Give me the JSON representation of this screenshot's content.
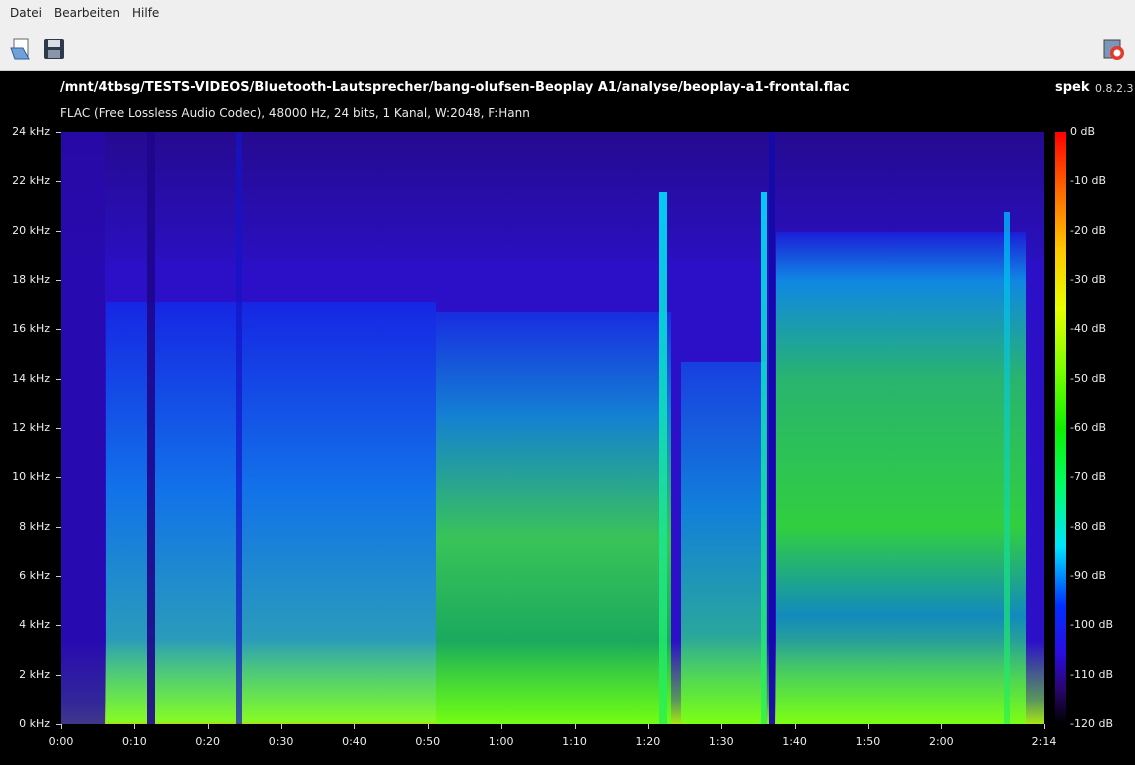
{
  "menubar": {
    "items": [
      "Datei",
      "Bearbeiten",
      "Hilfe"
    ]
  },
  "toolbar": {
    "icons": [
      "open-file-icon",
      "save-icon",
      "help-icon"
    ]
  },
  "header": {
    "filepath": "/mnt/4tbsg/TESTS-VIDEOS/Bluetooth-Lautsprecher/bang-olufsen-Beoplay A1/analyse/beoplay-a1-frontal.flac",
    "app_name": "spek",
    "app_version": "0.8.2.3",
    "format": "FLAC (Free Lossless Audio Codec), 48000 Hz, 24 bits, 1 Kanal, W:2048, F:Hann"
  },
  "y_axis": {
    "ticks": [
      "24 kHz",
      "22 kHz",
      "20 kHz",
      "18 kHz",
      "16 kHz",
      "14 kHz",
      "12 kHz",
      "10 kHz",
      "8 kHz",
      "6 kHz",
      "4 kHz",
      "2 kHz",
      "0 kHz"
    ]
  },
  "x_axis": {
    "ticks": [
      "0:00",
      "0:10",
      "0:20",
      "0:30",
      "0:40",
      "0:50",
      "1:00",
      "1:10",
      "1:20",
      "1:30",
      "1:40",
      "1:50",
      "2:00",
      "2:14"
    ]
  },
  "colorbar": {
    "ticks": [
      "0 dB",
      "-10 dB",
      "-20 dB",
      "-30 dB",
      "-40 dB",
      "-50 dB",
      "-60 dB",
      "-70 dB",
      "-80 dB",
      "-90 dB",
      "-100 dB",
      "-110 dB",
      "-120 dB"
    ],
    "colors": [
      "#ff0000",
      "#ff6a00",
      "#ffc800",
      "#7cff00",
      "#10f000",
      "#00e6ff",
      "#0030ff",
      "#2a0ce0",
      "#000000"
    ]
  }
}
